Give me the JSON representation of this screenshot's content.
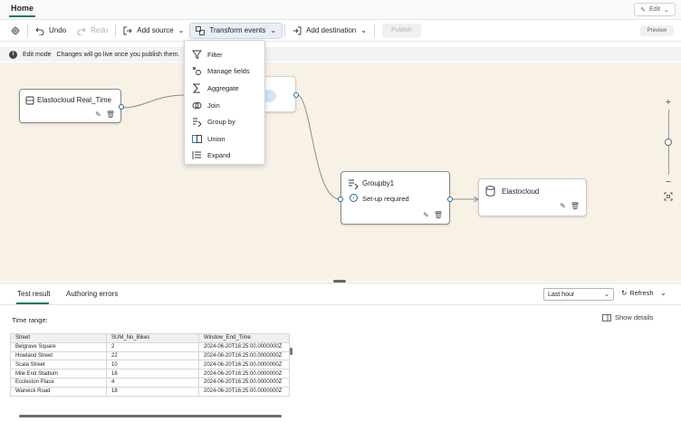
{
  "header": {
    "home_tab": "Home",
    "edit_label": "Edit"
  },
  "toolbar": {
    "undo": "Undo",
    "redo": "Redo",
    "add_source": "Add source",
    "transform_events": "Transform events",
    "add_destination": "Add destination",
    "publish": "Publish",
    "preview": "Preview"
  },
  "editbar": {
    "mode": "Edit mode",
    "message": "Changes will go live once you publish them."
  },
  "transform_menu": {
    "items": [
      {
        "label": "Filter",
        "icon": "filter-icon"
      },
      {
        "label": "Manage fields",
        "icon": "manage-fields-icon"
      },
      {
        "label": "Aggregate",
        "icon": "sigma-icon"
      },
      {
        "label": "Join",
        "icon": "join-icon"
      },
      {
        "label": "Group by",
        "icon": "group-by-icon"
      },
      {
        "label": "Union",
        "icon": "union-icon"
      },
      {
        "label": "Expand",
        "icon": "expand-icon"
      }
    ]
  },
  "canvas": {
    "source_node": {
      "title": "Elastocloud Real_Time"
    },
    "groupby_node": {
      "title": "Groupby1",
      "status": "Set-up required"
    },
    "destination_node": {
      "title": "Elastocloud"
    }
  },
  "bottom_panel": {
    "tabs": [
      "Test result",
      "Authoring errors"
    ],
    "time_range_option": "Last hour",
    "refresh": "Refresh",
    "time_range_label": "Time range:",
    "show_details": "Show details",
    "columns": [
      "Street",
      "SUM_No_Bikes",
      "Window_End_Time"
    ],
    "rows": [
      [
        "Belgrave Square",
        "2",
        "2024-06-20T16:25:00.0000000Z"
      ],
      [
        "Howland Street",
        "22",
        "2024-06-20T16:25:00.0000000Z"
      ],
      [
        "Scala Street",
        "10",
        "2024-06-20T16:25:00.0000000Z"
      ],
      [
        "Mile End Stadium",
        "16",
        "2024-06-20T16:25:00.0000000Z"
      ],
      [
        "Eccleston Place",
        "4",
        "2024-06-20T16:25:00.0000000Z"
      ],
      [
        "Warwick Road",
        "18",
        "2024-06-20T16:25:00.0000000Z"
      ]
    ]
  },
  "colors": {
    "accent": "#117865",
    "canvas_bg": "#f8f1e6",
    "port_border": "#1c6e9c"
  }
}
